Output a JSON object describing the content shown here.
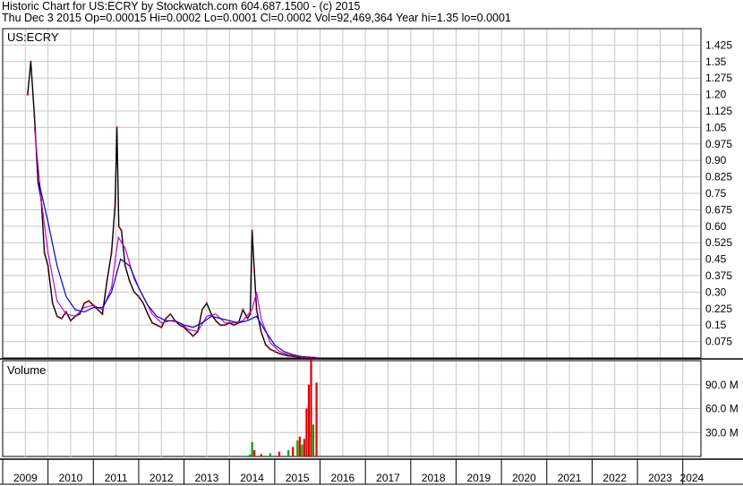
{
  "header": {
    "line1": "Historic Chart for US:ECRY by Stockwatch.com 604.687.1500 - (c) 2015",
    "line2": "Thu Dec  3 2015  Op=0.00015  Hi=0.0002  Lo=0.0001  Cl=0.0002  Vol=92,469,364  Year hi=1.35  lo=0.0001"
  },
  "colors": {
    "price": "#000000",
    "ma_short": "#cc00cc",
    "ma_long": "#0000cc",
    "volume_up": "#00a000",
    "volume_down": "#e00000",
    "grid": "#c8c8c8"
  },
  "chart_data": [
    {
      "type": "line",
      "title": "US:ECRY",
      "y_ticks": [
        1.425,
        1.35,
        1.275,
        1.2,
        1.125,
        1.05,
        0.975,
        0.9,
        0.825,
        0.75,
        0.675,
        0.6,
        0.525,
        0.45,
        0.375,
        0.3,
        0.225,
        0.15,
        0.075
      ],
      "y_tick_labels": [
        "1.425",
        "1.35",
        "1.275",
        "1.20",
        "1.125",
        "1.05",
        "0.975",
        "0.90",
        "0.825",
        "0.75",
        "0.675",
        "0.60",
        "0.525",
        "0.45",
        "0.375",
        "0.30",
        "0.225",
        "0.15",
        "0.075"
      ],
      "ylim": [
        0,
        1.5
      ],
      "x_tick_labels": [
        "2009",
        "2010",
        "2011",
        "2012",
        "2013",
        "2014",
        "2015",
        "2016",
        "2017",
        "2018",
        "2019",
        "2020",
        "2021",
        "2022",
        "2023",
        "2024"
      ],
      "xlim": [
        2009.0,
        2024.4
      ],
      "grid": true,
      "series": [
        {
          "x": [
            2009.55,
            2009.62,
            2009.7,
            2009.78,
            2009.85,
            2009.92,
            2010.0,
            2010.1,
            2010.2,
            2010.3,
            2010.4,
            2010.5,
            2010.6,
            2010.7,
            2010.8,
            2010.9,
            2011.0,
            2011.1,
            2011.2,
            2011.3,
            2011.4,
            2011.48,
            2011.52,
            2011.56,
            2011.62,
            2011.7,
            2011.8,
            2011.9,
            2012.0,
            2012.1,
            2012.2,
            2012.3,
            2012.4,
            2012.5,
            2012.6,
            2012.7,
            2012.8,
            2012.9,
            2013.0,
            2013.1,
            2013.2,
            2013.3,
            2013.4,
            2013.5,
            2013.6,
            2013.7,
            2013.8,
            2013.9,
            2014.0,
            2014.1,
            2014.2,
            2014.3,
            2014.4,
            2014.46,
            2014.5,
            2014.55,
            2014.6,
            2014.7,
            2014.8,
            2014.9,
            2015.0,
            2015.1,
            2015.2,
            2015.3,
            2015.4,
            2015.5,
            2015.6,
            2015.7,
            2015.8,
            2015.92
          ],
          "values": [
            1.2,
            1.35,
            1.1,
            0.8,
            0.72,
            0.48,
            0.42,
            0.25,
            0.19,
            0.18,
            0.21,
            0.17,
            0.19,
            0.2,
            0.25,
            0.26,
            0.24,
            0.22,
            0.2,
            0.35,
            0.48,
            0.7,
            1.05,
            0.6,
            0.58,
            0.42,
            0.35,
            0.3,
            0.28,
            0.25,
            0.2,
            0.16,
            0.15,
            0.14,
            0.18,
            0.2,
            0.17,
            0.15,
            0.14,
            0.12,
            0.1,
            0.12,
            0.22,
            0.25,
            0.2,
            0.17,
            0.15,
            0.15,
            0.16,
            0.15,
            0.16,
            0.22,
            0.18,
            0.2,
            0.58,
            0.4,
            0.22,
            0.12,
            0.06,
            0.04,
            0.03,
            0.02,
            0.015,
            0.01,
            0.008,
            0.005,
            0.003,
            0.002,
            0.001,
            0.0002
          ]
        },
        {
          "x": [
            2009.7,
            2009.85,
            2010.0,
            2010.2,
            2010.4,
            2010.6,
            2010.8,
            2011.0,
            2011.2,
            2011.4,
            2011.55,
            2011.7,
            2011.9,
            2012.1,
            2012.3,
            2012.5,
            2012.7,
            2012.9,
            2013.1,
            2013.3,
            2013.5,
            2013.7,
            2013.9,
            2014.1,
            2014.3,
            2014.5,
            2014.6,
            2014.7,
            2014.9,
            2015.1,
            2015.3,
            2015.5,
            2015.7,
            2015.92
          ],
          "values": [
            1.05,
            0.72,
            0.48,
            0.26,
            0.2,
            0.19,
            0.23,
            0.24,
            0.22,
            0.32,
            0.55,
            0.5,
            0.36,
            0.28,
            0.2,
            0.16,
            0.17,
            0.16,
            0.13,
            0.12,
            0.19,
            0.2,
            0.16,
            0.16,
            0.17,
            0.22,
            0.3,
            0.18,
            0.07,
            0.03,
            0.015,
            0.006,
            0.002,
            0.0005
          ]
        },
        {
          "x": [
            2009.8,
            2010.0,
            2010.2,
            2010.4,
            2010.6,
            2010.8,
            2011.0,
            2011.2,
            2011.4,
            2011.6,
            2011.8,
            2012.0,
            2012.2,
            2012.4,
            2012.6,
            2012.8,
            2013.0,
            2013.2,
            2013.4,
            2013.6,
            2013.8,
            2014.0,
            2014.2,
            2014.4,
            2014.6,
            2014.8,
            2015.0,
            2015.2,
            2015.4,
            2015.6,
            2015.92
          ],
          "values": [
            0.8,
            0.62,
            0.42,
            0.28,
            0.22,
            0.21,
            0.23,
            0.23,
            0.3,
            0.45,
            0.42,
            0.32,
            0.24,
            0.19,
            0.17,
            0.17,
            0.15,
            0.14,
            0.16,
            0.19,
            0.18,
            0.17,
            0.16,
            0.17,
            0.19,
            0.12,
            0.06,
            0.03,
            0.015,
            0.006,
            0.002
          ]
        }
      ]
    },
    {
      "type": "bar",
      "title": "Volume",
      "y_ticks": [
        30,
        60,
        90
      ],
      "y_tick_labels": [
        "30.0 M",
        "60.0 M",
        "90.0 M"
      ],
      "ylim": [
        0,
        120
      ],
      "grid": true,
      "x": [
        2009.5,
        2010.0,
        2010.5,
        2011.0,
        2011.5,
        2012.0,
        2012.5,
        2013.0,
        2013.5,
        2014.0,
        2014.3,
        2014.45,
        2014.5,
        2014.55,
        2014.7,
        2014.9,
        2015.1,
        2015.3,
        2015.4,
        2015.5,
        2015.55,
        2015.6,
        2015.65,
        2015.7,
        2015.75,
        2015.8,
        2015.85,
        2015.92
      ],
      "values": [
        0.5,
        0.5,
        0.5,
        0.8,
        1.5,
        0.6,
        0.5,
        0.5,
        0.5,
        0.6,
        0.8,
        2.5,
        18,
        8,
        3,
        4,
        6,
        8,
        12,
        20,
        25,
        15,
        22,
        60,
        90,
        122,
        40,
        92.5
      ],
      "up": [
        true,
        false,
        true,
        false,
        true,
        false,
        true,
        false,
        true,
        false,
        true,
        true,
        true,
        false,
        false,
        true,
        false,
        true,
        false,
        true,
        false,
        true,
        false,
        false,
        false,
        false,
        true,
        false
      ]
    }
  ]
}
